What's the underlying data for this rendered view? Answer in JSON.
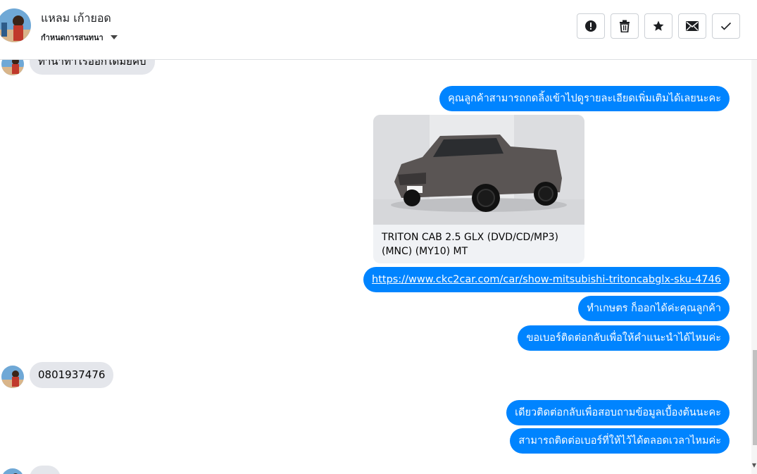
{
  "header": {
    "contact_name": "แหลม เก้ายอด",
    "conversation_actions_label": "กำหนดการสนทนา",
    "buttons": {
      "report": "report-icon",
      "delete": "trash-icon",
      "star": "star-icon",
      "mark_unread": "envelope-icon",
      "done": "checkmark-icon"
    }
  },
  "thread": {
    "incoming_partial": "ทำนาทำไรออกได้มั้ยคับ",
    "outgoing_1": "คุณลูกค้าสามารถกดลิ้งเข้าไปดูรายละเอียดเพิ่มเติมได้เลยนะคะ",
    "card_title": "TRITON CAB 2.5 GLX (DVD/CD/MP3) (MNC) (MY10) MT",
    "link": "https://www.ckc2car.com/car/show-mitsubishi-tritoncabglx-sku-4746",
    "outgoing_2": "ทำเกษตร ก็ออกได้ค่ะคุณลูกค้า",
    "outgoing_3": "ขอเบอร์ติดต่อกลับเพื่อให้คำแนะนำได้ไหมค่ะ",
    "incoming_phone": "0801937476",
    "outgoing_4": "เดียวติดต่อกลับเพื่อสอบถามข้อมูลเบื้องต้นนะคะ",
    "outgoing_5": "สามารถติดต่อเบอร์ที่ให้ไว้ได้ตลอดเวลาไหมค่ะ"
  },
  "colors": {
    "outgoing_bubble": "#0084ff",
    "incoming_bubble": "#e4e6eb"
  }
}
